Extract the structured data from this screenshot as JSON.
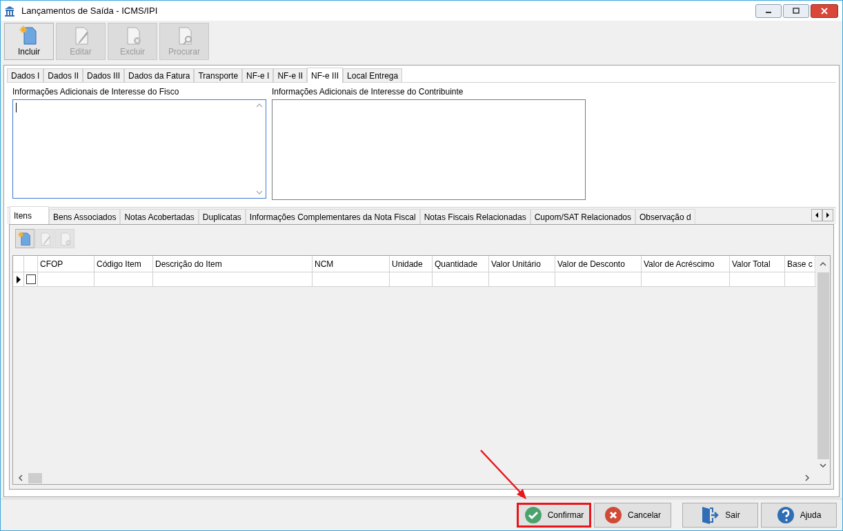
{
  "window": {
    "title": "Lançamentos de Saída - ICMS/IPI"
  },
  "toolbar": [
    {
      "label": "Incluir",
      "kind": "add",
      "disabled": false
    },
    {
      "label": "Editar",
      "kind": "edit",
      "disabled": true
    },
    {
      "label": "Excluir",
      "kind": "delete",
      "disabled": true
    },
    {
      "label": "Procurar",
      "kind": "search",
      "disabled": true
    }
  ],
  "tabs": [
    {
      "label": "Dados I",
      "selected": false
    },
    {
      "label": "Dados II",
      "selected": false
    },
    {
      "label": "Dados III",
      "selected": false
    },
    {
      "label": "Dados da Fatura",
      "selected": false
    },
    {
      "label": "Transporte",
      "selected": false
    },
    {
      "label": "NF-e I",
      "selected": false
    },
    {
      "label": "NF-e II",
      "selected": false
    },
    {
      "label": "NF-e III",
      "selected": true
    },
    {
      "label": "Local Entrega",
      "selected": false
    }
  ],
  "fields": [
    {
      "label": "Informações Adicionais de Interesse do Fisco",
      "focused": true
    },
    {
      "label": "Informações Adicionais de Interesse do Contribuinte",
      "focused": false
    }
  ],
  "sub_tabs": [
    {
      "label": "Itens",
      "selected": true
    },
    {
      "label": "Bens Associados",
      "selected": false
    },
    {
      "label": "Notas Acobertadas",
      "selected": false
    },
    {
      "label": "Duplicatas",
      "selected": false
    },
    {
      "label": "Informações Complementares da Nota Fiscal",
      "selected": false
    },
    {
      "label": "Notas Fiscais Relacionadas",
      "selected": false
    },
    {
      "label": "Cupom/SAT Relacionados",
      "selected": false
    },
    {
      "label": "Observação d",
      "selected": false
    }
  ],
  "items_toolbar": [
    {
      "kind": "add",
      "disabled": false
    },
    {
      "kind": "edit",
      "disabled": true
    },
    {
      "kind": "delete",
      "disabled": true
    }
  ],
  "table": {
    "columns": [
      "CFOP",
      "Código Item",
      "Descrição do Item",
      "NCM",
      "Unidade",
      "Quantidade",
      "Valor Unitário",
      "Valor de Desconto",
      "Valor de Acréscimo",
      "Valor Total",
      "Base c"
    ],
    "rows": [
      {
        "current": true,
        "checked": false
      }
    ]
  },
  "buttons": [
    {
      "label": "Confirmar",
      "kind": "confirm",
      "highlighted": true
    },
    {
      "label": "Cancelar",
      "kind": "cancel",
      "highlighted": false
    },
    {
      "label": "Sair",
      "kind": "exit",
      "highlighted": false
    },
    {
      "label": "Ajuda",
      "kind": "help",
      "highlighted": false
    }
  ]
}
